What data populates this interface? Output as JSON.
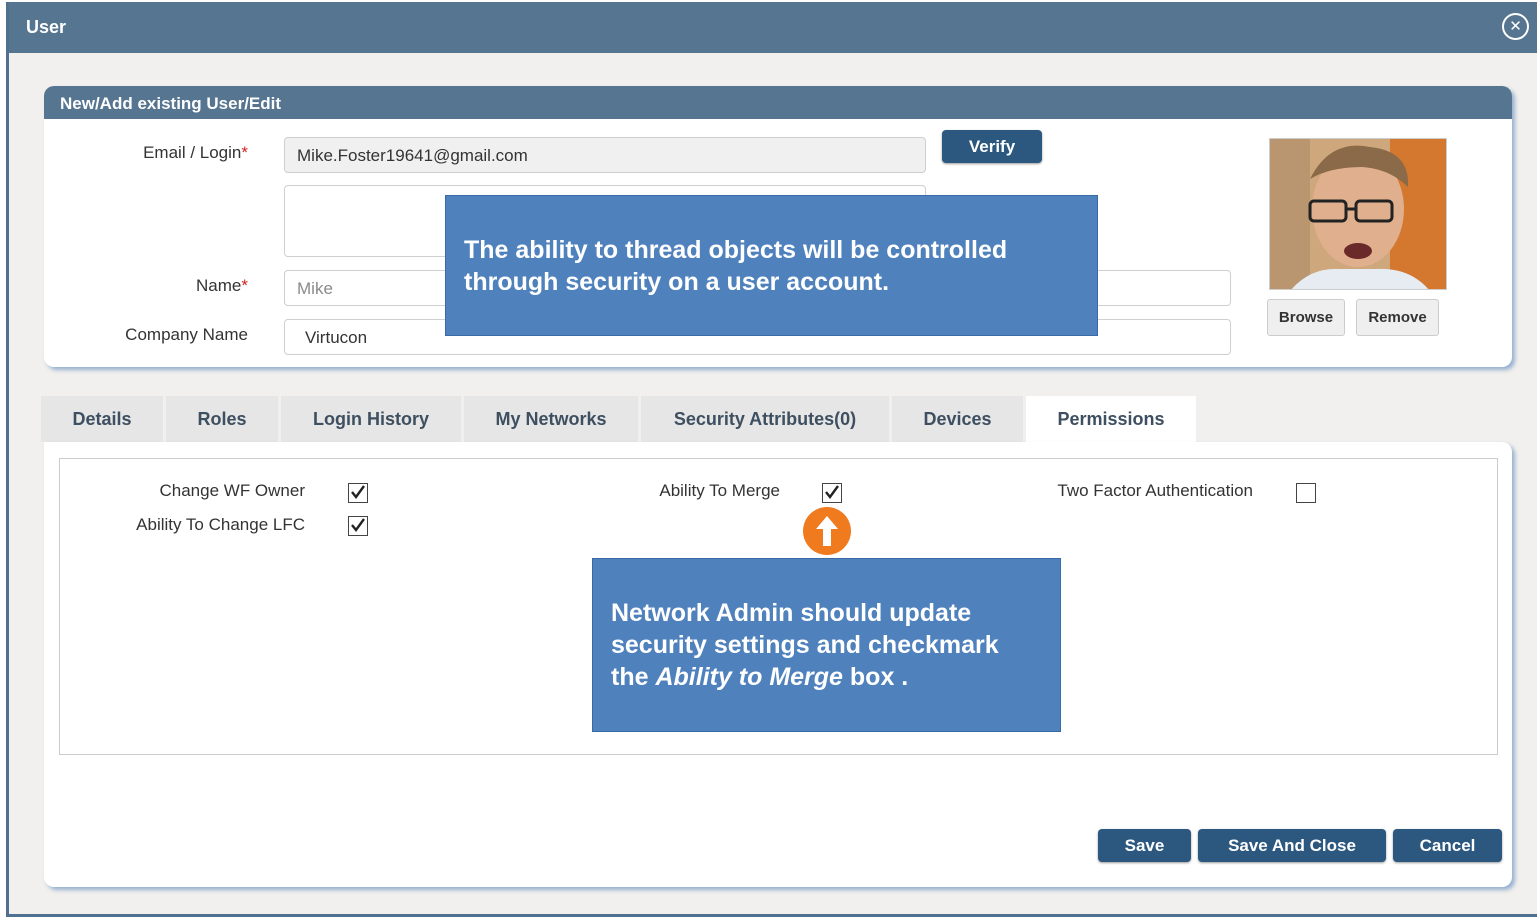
{
  "window": {
    "title": "User",
    "close_icon": "close-circle-icon"
  },
  "user_section": {
    "header": "New/Add existing User/Edit",
    "email": {
      "label": "Email / Login",
      "required_mark": "*",
      "value": "Mike.Foster19641@gmail.com"
    },
    "verify_label": "Verify",
    "name": {
      "label": "Name",
      "required_mark": "*",
      "value": "Mike"
    },
    "company": {
      "label": "Company Name",
      "value": "Virtucon"
    },
    "browse_label": "Browse",
    "remove_label": "Remove"
  },
  "tabs": [
    {
      "label": "Details"
    },
    {
      "label": "Roles"
    },
    {
      "label": "Login History"
    },
    {
      "label": "My Networks"
    },
    {
      "label": "Security Attributes(0)"
    },
    {
      "label": "Devices"
    },
    {
      "label": "Permissions",
      "active": true
    }
  ],
  "permissions": [
    {
      "label": "Change WF Owner",
      "checked": true
    },
    {
      "label": "Ability To Change LFC",
      "checked": true
    },
    {
      "label": "Ability To Merge",
      "checked": true
    },
    {
      "label": "Two Factor Authentication",
      "checked": false
    }
  ],
  "callouts": {
    "top": "The ability to thread objects will be controlled through security on a user account.",
    "bottom_prefix": "Network Admin should update security settings and checkmark the ",
    "bottom_emphasis": "Ability to Merge",
    "bottom_suffix": " box ."
  },
  "footer": {
    "save_label": "Save",
    "save_close_label": "Save And Close",
    "cancel_label": "Cancel"
  },
  "colors": {
    "title_bar": "#557590",
    "button": "#2c5880",
    "callout": "#4f81bd",
    "arrow": "#f07a1e"
  }
}
